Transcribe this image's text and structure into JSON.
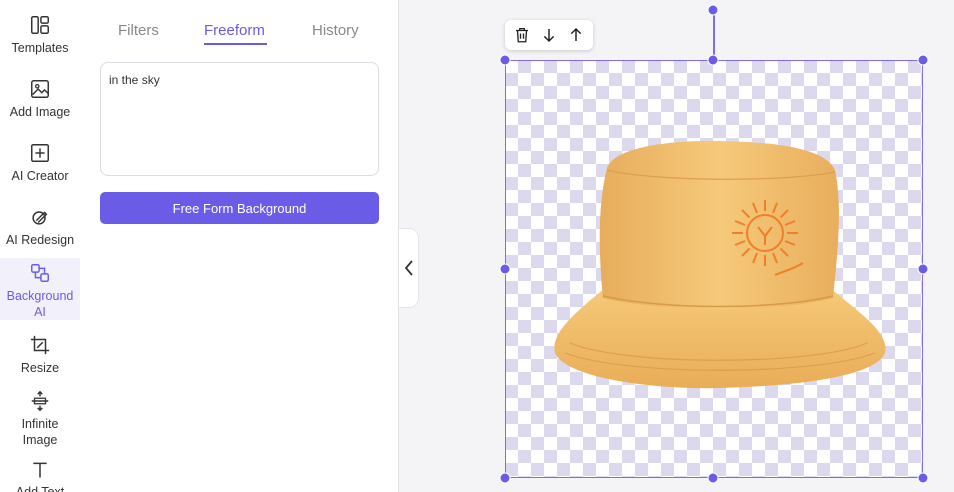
{
  "sidebar": {
    "items": [
      {
        "label": "Templates",
        "icon": "templates-icon",
        "active": false
      },
      {
        "label": "Add Image",
        "icon": "image-icon",
        "active": false
      },
      {
        "label": "AI Creator",
        "icon": "plus-square-icon",
        "active": false
      },
      {
        "label": "AI Redesign",
        "icon": "brush-icon",
        "active": false
      },
      {
        "label": "Background AI",
        "icon": "background-layers-icon",
        "active": true
      },
      {
        "label": "Resize",
        "icon": "crop-icon",
        "active": false
      },
      {
        "label": "Infinite Image",
        "icon": "expand-vertical-icon",
        "active": false
      },
      {
        "label": "Add Text",
        "icon": "text-icon",
        "active": false
      }
    ]
  },
  "panel": {
    "tabs": [
      {
        "label": "Filters",
        "active": false
      },
      {
        "label": "Freeform",
        "active": true
      },
      {
        "label": "History",
        "active": false
      }
    ],
    "prompt_value": "in the sky",
    "generate_label": "Free Form Background"
  },
  "canvas": {
    "toolbar": [
      "trash-icon",
      "move-down-icon",
      "move-up-icon"
    ],
    "image": "bucket-hat"
  },
  "colors": {
    "accent": "#6b5ce7",
    "checker": "#dcd9ef",
    "hat": "#f3be6c",
    "logo": "#ef7f2a"
  }
}
